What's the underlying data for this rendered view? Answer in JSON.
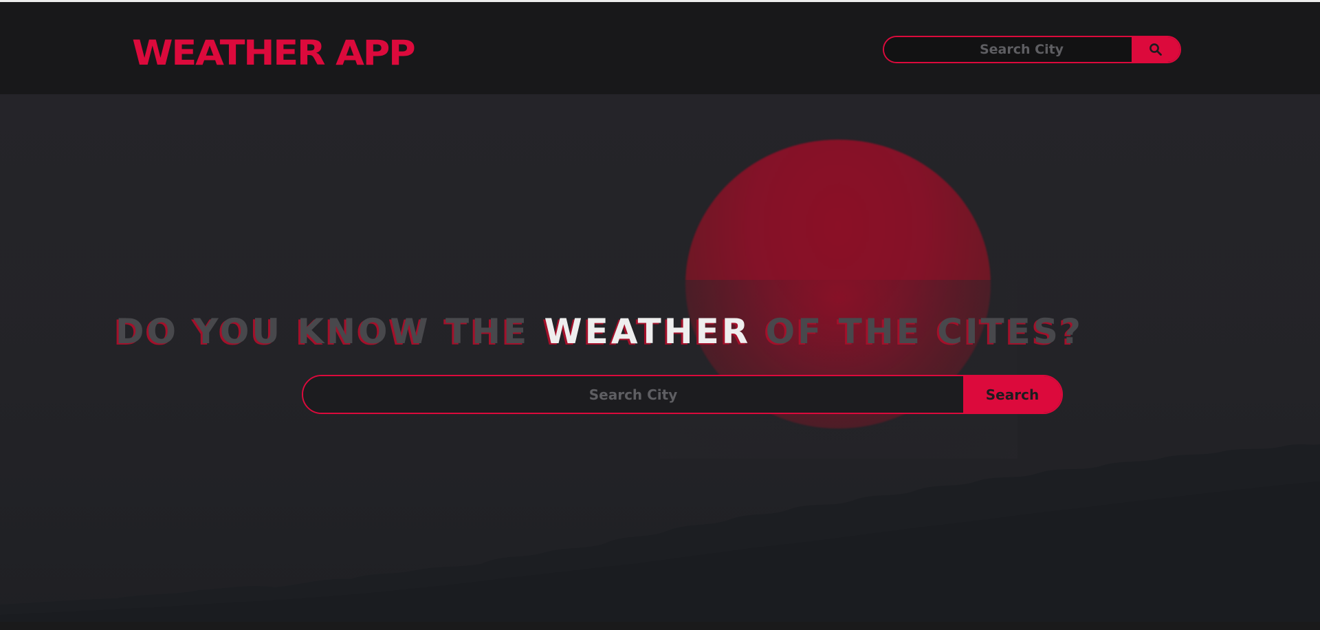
{
  "colors": {
    "accent": "#dc0a3c",
    "placeholder": "#5e5e62",
    "button_text": "#1c1c1f"
  },
  "navbar": {
    "logo": "WEATHER APP",
    "search": {
      "placeholder": "Search City",
      "button_icon": "search-icon"
    }
  },
  "hero": {
    "headline_before": "DO YOU KNOW THE ",
    "headline_highlight": "WEATHER",
    "headline_after": " OF THE CITES?",
    "search": {
      "placeholder": "Search City",
      "button_label": "Search"
    }
  }
}
